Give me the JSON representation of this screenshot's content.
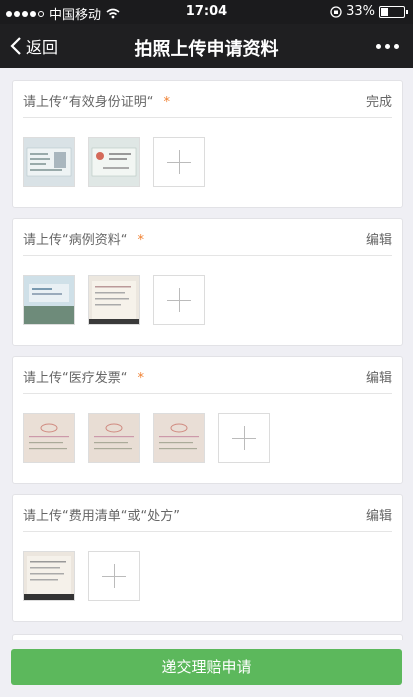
{
  "status": {
    "carrier": "中国移动",
    "time": "17:04",
    "battery": "33%",
    "battery_level": 0.33,
    "icons": [
      "signal-dots",
      "wifi-icon",
      "orientation-lock-icon",
      "battery-icon"
    ]
  },
  "nav": {
    "back_label": "返回",
    "title": "拍照上传申请资料",
    "more_icon": "more-dots-icon"
  },
  "sections": [
    {
      "title": "请上传“有效身份证明“",
      "required_mark": "*",
      "action": "完成",
      "photos": 2
    },
    {
      "title": "请上传“病例资料“",
      "required_mark": "*",
      "action": "编辑",
      "photos": 2
    },
    {
      "title": "请上传“医疗发票“",
      "required_mark": "*",
      "action": "编辑",
      "photos": 3
    },
    {
      "title": "请上传“费用清单“或“处方”",
      "required_mark": "",
      "action": "编辑",
      "photos": 1
    }
  ],
  "submit_label": "递交理赔申请",
  "colors": {
    "submit": "#5cb85c",
    "required": "#f08030",
    "navbar": "#1f1f21"
  }
}
